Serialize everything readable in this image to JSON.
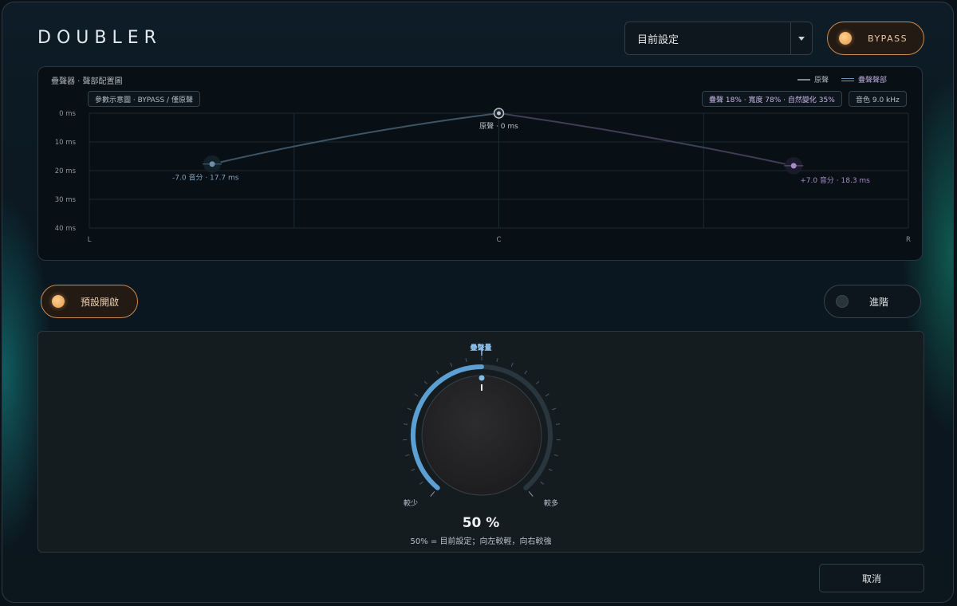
{
  "app": {
    "title": "DOUBLER"
  },
  "header": {
    "preset_value": "目前設定",
    "bypass_label": "BYPASS"
  },
  "graph": {
    "title": "疊聲器 · 聲部配置圖",
    "legend": {
      "original": "原聲",
      "doubled": "疊聲聲部"
    },
    "chip_left": "參數示意圖 · BYPASS / 僅原聲",
    "chip_params": "疊聲 18% · 寬度 78% · 自然變化 35%",
    "chip_tone": "音色 9.0 kHz",
    "y_ticks": [
      "0 ms",
      "10 ms",
      "20 ms",
      "30 ms",
      "40 ms"
    ],
    "x_ticks": [
      "L",
      "C",
      "R"
    ],
    "points": [
      {
        "pan": -0.7,
        "delay_ms": 17.7,
        "label": "-7.0 音分 · 17.7 ms"
      },
      {
        "pan": 0.0,
        "delay_ms": 0,
        "label": "原聲 · 0 ms"
      },
      {
        "pan": 0.72,
        "delay_ms": 18.3,
        "label": "+7.0 音分 · 18.3 ms"
      }
    ],
    "colors": {
      "left_voice": "#6e8fa8",
      "right_voice": "#a58cc4",
      "center": "#b8c2ca"
    }
  },
  "controls": {
    "preset_toggle_label": "預設開啟",
    "advanced_label": "進階"
  },
  "knob": {
    "label": "疊聲量",
    "value_percent": 50,
    "value_text": "50 %",
    "hint": "50% = 目前設定；向左較輕，向右較強",
    "min_label": "較少",
    "max_label": "較多",
    "accent": "#5b9fd3"
  },
  "footer": {
    "cancel_label": "取消"
  }
}
